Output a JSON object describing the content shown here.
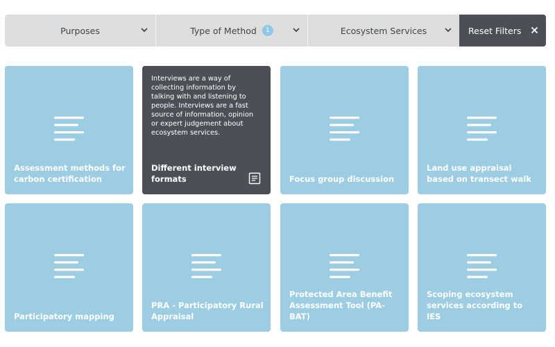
{
  "filters": [
    {
      "label": "Purposes",
      "badge": ""
    },
    {
      "label": "Type of Method",
      "badge": "1"
    },
    {
      "label": "Ecosystem Services",
      "badge": ""
    }
  ],
  "reset": {
    "label": "Reset Filters"
  },
  "colors": {
    "card": "#9ccde3",
    "card_active": "#4c5056",
    "filter_bg": "#dedede",
    "badge": "#8ec8e6"
  },
  "cards": [
    {
      "title": "Assessment methods for carbon certification",
      "icon": "lines-icon"
    },
    {
      "title": "Different interview formats",
      "description": "Interviews are a way of collecting information by talking with and listening to people. Interviews are a fast source of information, opinion or expert judgement about ecosystem services.",
      "icon": "document-icon"
    },
    {
      "title": "Focus group discussion",
      "icon": "lines-icon"
    },
    {
      "title": "Land use appraisal based on transect walk",
      "icon": "lines-icon"
    },
    {
      "title": "Participatory mapping",
      "icon": "lines-icon"
    },
    {
      "title": "PRA - Participatory Rural Appraisal",
      "icon": "lines-icon"
    },
    {
      "title": "Protected Area Benefit Assessment Tool (PA-BAT)",
      "icon": "lines-icon"
    },
    {
      "title": "Scoping ecosystem services according to IES",
      "icon": "lines-icon"
    }
  ]
}
